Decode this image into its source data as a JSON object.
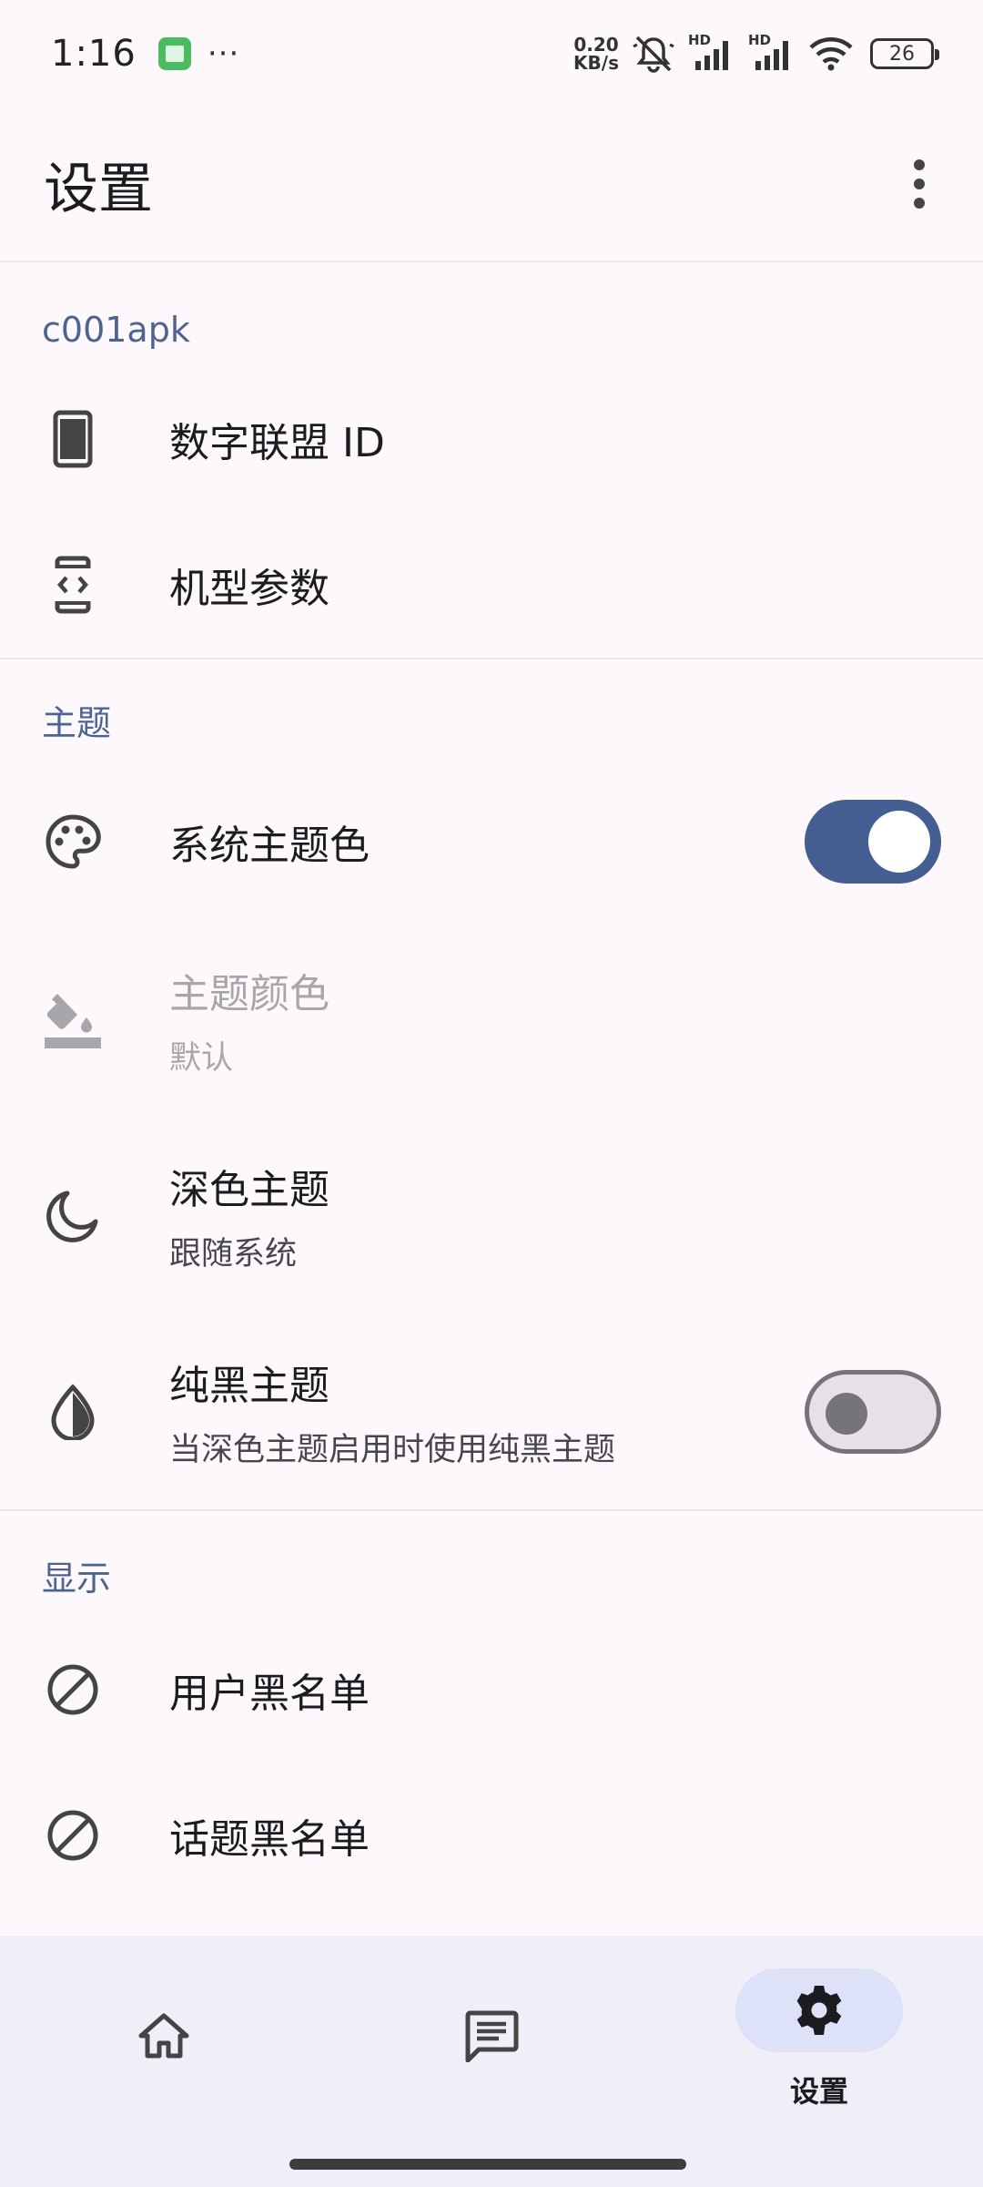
{
  "status_bar": {
    "time": "1:16",
    "more": "···",
    "speed_value": "0.20",
    "speed_unit": "KB/s",
    "signal1_label": "HD",
    "signal2_label": "HD",
    "battery": "26"
  },
  "app_bar": {
    "title": "设置"
  },
  "sections": {
    "c001apk": {
      "header": "c001apk",
      "digital_id": "数字联盟 ID",
      "device_params": "机型参数"
    },
    "theme": {
      "header": "主题",
      "system_color": "系统主题色",
      "system_color_on": true,
      "theme_color": "主题颜色",
      "theme_color_summary": "默认",
      "dark_theme": "深色主题",
      "dark_theme_summary": "跟随系统",
      "black_theme": "纯黑主题",
      "black_theme_summary": "当深色主题启用时使用纯黑主题",
      "black_theme_on": false
    },
    "display": {
      "header": "显示",
      "user_blacklist": "用户黑名单",
      "topic_blacklist": "话题黑名单"
    }
  },
  "bottom_nav": {
    "settings_label": "设置"
  },
  "colors": {
    "accent": "#445e91",
    "section_header": "#4d6390",
    "nav_active_pill": "#dde2f9"
  }
}
